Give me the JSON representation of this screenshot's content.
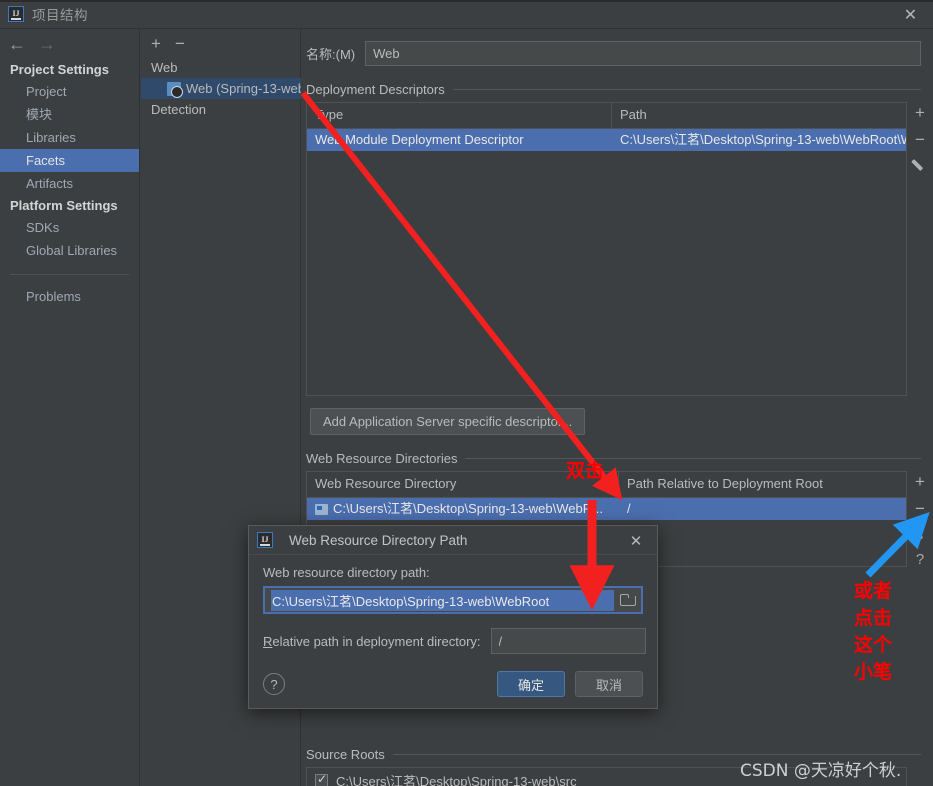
{
  "window": {
    "title": "项目结构",
    "logo_text": "IJ",
    "close_label": "✕"
  },
  "sidebar": {
    "back_icon": "←",
    "forward_icon": "→",
    "groups": [
      {
        "label": "Project Settings",
        "items": [
          {
            "label": "Project",
            "selected": false
          },
          {
            "label": "模块",
            "selected": false
          },
          {
            "label": "Libraries",
            "selected": false
          },
          {
            "label": "Facets",
            "selected": true
          },
          {
            "label": "Artifacts",
            "selected": false
          }
        ]
      },
      {
        "label": "Platform Settings",
        "items": [
          {
            "label": "SDKs",
            "selected": false
          },
          {
            "label": "Global Libraries",
            "selected": false
          }
        ]
      }
    ],
    "problems_label": "Problems"
  },
  "modules": {
    "add_label": "+",
    "remove_label": "−",
    "root_label": "Web",
    "selected_item": "Web (Spring-13-web",
    "detection_label": "Detection"
  },
  "main": {
    "name_label": "名称:(M)",
    "name_value": "Web",
    "deployment": {
      "group_label": "Deployment Descriptors",
      "columns": [
        "Type",
        "Path"
      ],
      "rows": [
        {
          "type": "Web Module Deployment Descriptor",
          "path": "C:\\Users\\江茗\\Desktop\\Spring-13-web\\WebRoot\\W"
        }
      ],
      "toolbar": {
        "add": "+",
        "remove": "−",
        "edit": "edit-pencil-icon"
      }
    },
    "add_descriptor_button": "Add Application Server specific descriptor...",
    "web_resources": {
      "group_label": "Web Resource Directories",
      "columns": [
        "Web Resource Directory",
        "Path Relative to Deployment Root"
      ],
      "rows": [
        {
          "directory": "C:\\Users\\江茗\\Desktop\\Spring-13-web\\WebR...",
          "relative": "/"
        }
      ],
      "toolbar": {
        "add": "+",
        "remove": "−",
        "edit": "edit-pencil-icon",
        "help": "?"
      }
    },
    "source_roots": {
      "group_label": "Source Roots",
      "rows": [
        {
          "checked": true,
          "path": "C:\\Users\\江茗\\Desktop\\Spring-13-web\\src"
        }
      ]
    }
  },
  "dialog": {
    "title": "Web Resource Directory Path",
    "logo_text": "IJ",
    "close_label": "✕",
    "path_label": "Web resource directory path:",
    "path_value": "C:\\Users\\江茗\\Desktop\\Spring-13-web\\WebRoot",
    "browse_icon": "folder-browse-icon",
    "relative_label_prefix": "R",
    "relative_label_rest": "elative path in deployment directory:",
    "relative_value": "/",
    "help_label": "?",
    "ok_label": "确定",
    "cancel_label": "取消"
  },
  "annotations": {
    "double_click": "双击",
    "or_click_pencil_lines": [
      "或者",
      "点击",
      "这个",
      "小笔"
    ],
    "color": "#ff0000",
    "arrow_color_red": "#f32020",
    "arrow_color_blue": "#2196f3"
  },
  "watermark": "CSDN @天凉好个秋."
}
